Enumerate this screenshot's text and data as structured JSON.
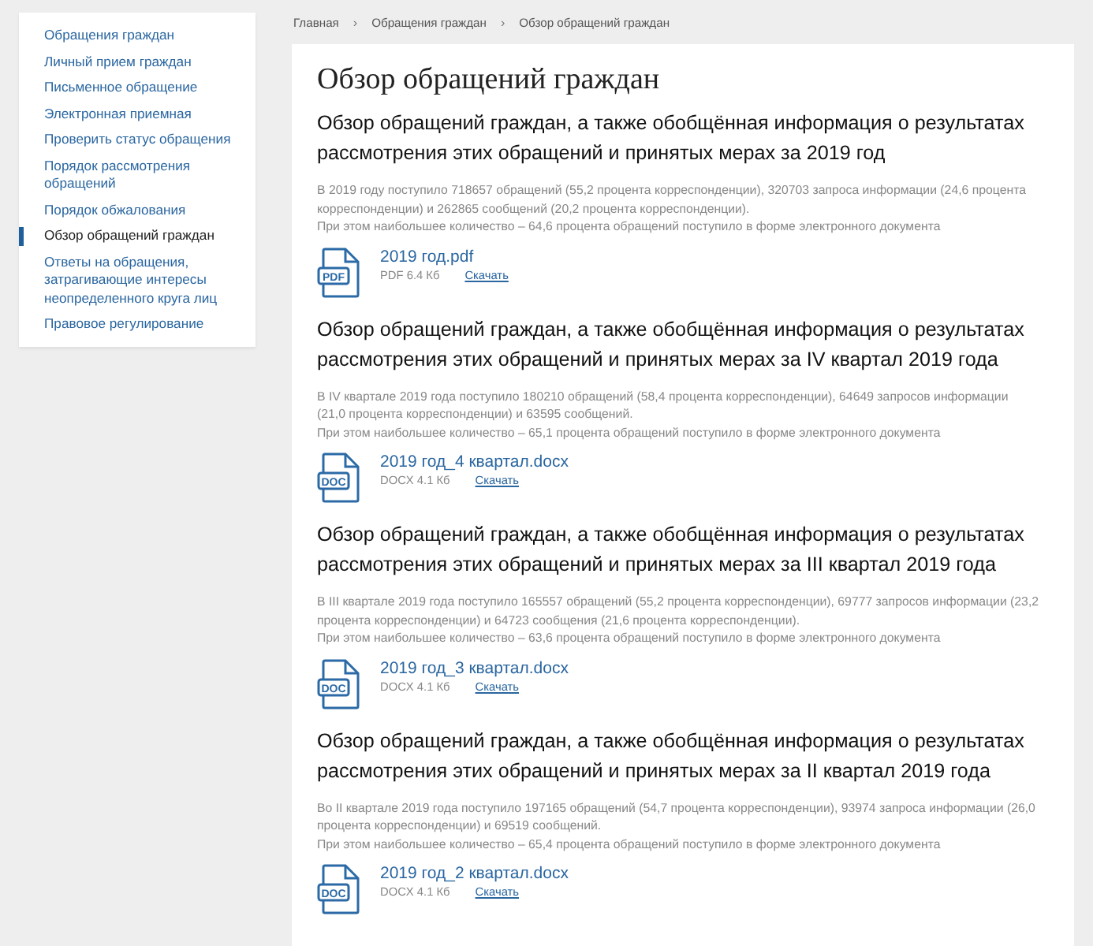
{
  "sidebar": {
    "items": [
      {
        "label": "Обращения граждан",
        "selected": false
      },
      {
        "label": "Личный прием граждан",
        "selected": false
      },
      {
        "label": "Письменное обращение",
        "selected": false
      },
      {
        "label": "Электронная приемная",
        "selected": false
      },
      {
        "label": "Проверить статус обращения",
        "selected": false
      },
      {
        "label": "Порядок рассмотрения обращений",
        "selected": false
      },
      {
        "label": "Порядок обжалования",
        "selected": false
      },
      {
        "label": "Обзор обращений граждан",
        "selected": true
      },
      {
        "label": "Ответы на обращения, затрагивающие интересы неопределенного круга лиц",
        "selected": false
      },
      {
        "label": "Правовое регулирование",
        "selected": false
      }
    ]
  },
  "breadcrumbs": [
    "Главная",
    "Обращения граждан",
    "Обзор обращений граждан"
  ],
  "breadcrumb_separator": "›",
  "page_title": "Обзор обращений граждан",
  "sections": [
    {
      "heading": "Обзор обращений граждан, а также обобщённая информация о результатах рассмотрения этих обращений и принятых мерах за 2019 год",
      "paragraphs": [
        "В 2019 году поступило 718657 обращений (55,2 процента корреспонденции), 320703 запроса информации (24,6 процента корреспонденции) и 262865 сообщений (20,2 процента корреспонденции).",
        "При этом наибольшее количество – 64,6 процента обращений поступило в форме электронного документа"
      ],
      "file": {
        "icon_label": "PDF",
        "name": "2019 год.pdf",
        "meta": "PDF 6.4 Кб",
        "action": "Скачать"
      }
    },
    {
      "heading": "Обзор обращений граждан, а также обобщённая информация о результатах рассмотрения этих обращений и принятых мерах за IV квартал 2019 года",
      "paragraphs": [
        "В IV квартале 2019 года поступило 180210 обращений (58,4 процента корреспонденции), 64649 запросов информации (21,0 процента корреспонденции) и 63595 сообщений.",
        "При этом наибольшее количество – 65,1 процента обращений поступило в форме электронного документа"
      ],
      "file": {
        "icon_label": "DOC",
        "name": "2019 год_4 квартал.docx",
        "meta": "DOCX 4.1 Кб",
        "action": "Скачать"
      }
    },
    {
      "heading": "Обзор обращений граждан, а также обобщённая информация о результатах рассмотрения этих обращений и принятых мерах за III квартал 2019 года",
      "paragraphs": [
        "В III квартале 2019 года поступило 165557 обращений (55,2 процента корреспонденции), 69777 запросов информации (23,2 процента корреспонденции) и 64723 сообщения (21,6 процента корреспонденции).",
        "При этом наибольшее количество – 63,6 процента обращений поступило в форме электронного документа"
      ],
      "file": {
        "icon_label": "DOC",
        "name": "2019 год_3 квартал.docx",
        "meta": "DOCX 4.1 Кб",
        "action": "Скачать"
      }
    },
    {
      "heading": "Обзор обращений граждан, а также обобщённая информация о результатах рассмотрения этих обращений и принятых мерах за II квартал 2019 года",
      "paragraphs": [
        "Во II квартале 2019 года поступило 197165 обращений (54,7 процента корреспонденции), 93974 запроса информации (26,0 процента корреспонденции) и 69519 сообщений.",
        "При этом наибольшее количество – 65,4 процента обращений поступило в форме электронного документа"
      ],
      "file": {
        "icon_label": "DOC",
        "name": "2019 год_2 квартал.docx",
        "meta": "DOCX 4.1 Кб",
        "action": "Скачать"
      }
    }
  ]
}
